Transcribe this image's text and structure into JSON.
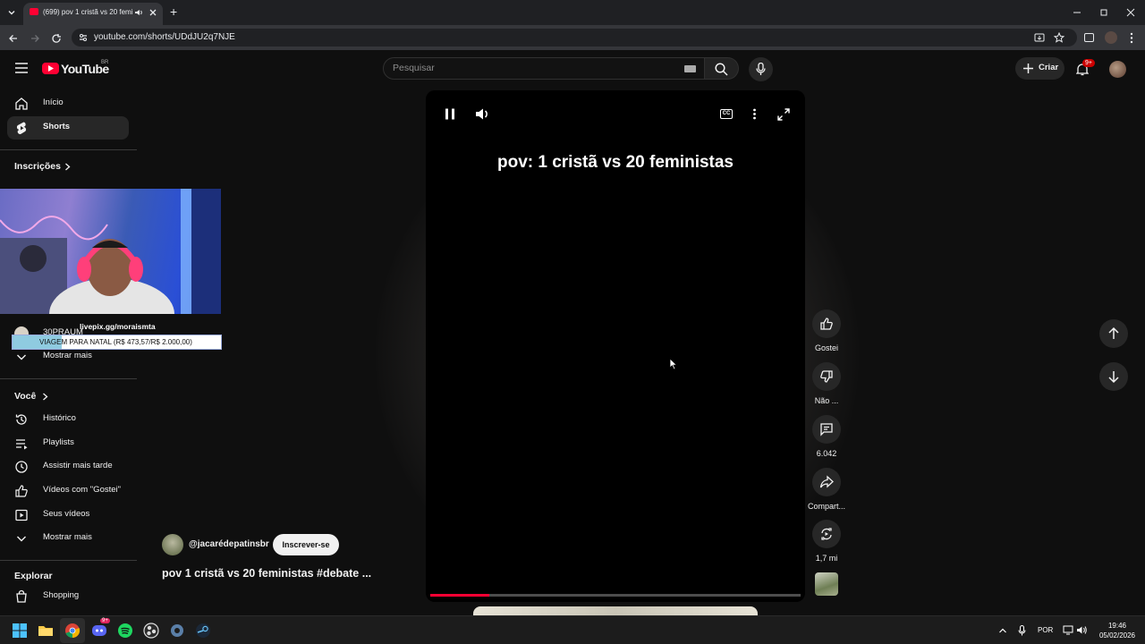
{
  "browser": {
    "tab_title": "(699) pov 1 cristã vs 20 femi",
    "new_tab": "+",
    "url": "youtube.com/shorts/UDdJU2q7NJE"
  },
  "youtube": {
    "logo_text": "YouTube",
    "logo_region": "BR",
    "search_placeholder": "Pesquisar",
    "create_label": "Criar",
    "notifications_badge": "9+"
  },
  "sidebar": {
    "main": [
      {
        "label": "Início",
        "icon": "home-icon"
      },
      {
        "label": "Shorts",
        "icon": "shorts-icon",
        "active": true
      }
    ],
    "subscriptions_title": "Inscrições",
    "subscriptions": [
      {
        "label": "30PRAUM"
      }
    ],
    "subscriptions_more": "Mostrar mais",
    "you_title": "Você",
    "you": [
      {
        "label": "Histórico",
        "icon": "history-icon"
      },
      {
        "label": "Playlists",
        "icon": "playlists-icon"
      },
      {
        "label": "Assistir mais tarde",
        "icon": "watch-later-icon"
      },
      {
        "label": "Vídeos com \"Gostei\"",
        "icon": "like-icon"
      },
      {
        "label": "Seus vídeos",
        "icon": "your-videos-icon"
      }
    ],
    "you_more": "Mostrar mais",
    "explore_title": "Explorar",
    "explore": [
      {
        "label": "Shopping",
        "icon": "shopping-icon"
      }
    ]
  },
  "short": {
    "caption": "pov: 1 cristã vs 20 feministas",
    "channel": "@jacarédepatinsbr",
    "subscribe_label": "Inscrever-se",
    "title": "pov 1 cristã vs 20 feministas #debate ...",
    "progress": 0.16
  },
  "actions": {
    "like": "Gostei",
    "dislike": "Não ...",
    "comments": "6.042",
    "share": "Compart...",
    "remix": "1,7 mi"
  },
  "overlay": {
    "donation_url": "livepix.gg/moraismta",
    "goal_label": "VIAGEM PARA NATAL (R$ 473,57/R$ 2.000,00)",
    "goal_progress": 0.2368
  },
  "taskbar": {
    "language": "POR",
    "time": "19:46",
    "date": "05/02/2026",
    "discord_badge": "9+"
  },
  "colors": {
    "accent_red": "#ff0033",
    "bg": "#0f0f0f",
    "chip": "#272727"
  }
}
